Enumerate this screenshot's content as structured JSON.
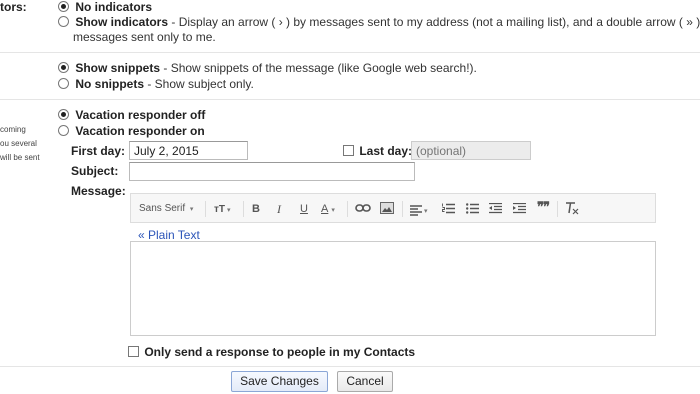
{
  "indicators": {
    "section_label": "tors:",
    "none_label": "No indicators",
    "show_label": "Show indicators",
    "show_desc": " - Display an arrow ( › ) by messages sent to my address (not a mailing list), and a double arrow ( » ) by",
    "show_desc_line2": "messages sent only to me."
  },
  "snippets": {
    "show_label": "Show snippets",
    "show_desc": " - Show snippets of the message (like Google web search!).",
    "none_label": "No snippets",
    "none_desc": " - Show subject only."
  },
  "vacation": {
    "side_lines": [
      "coming",
      "ou several",
      "will be sent"
    ],
    "off_label": "Vacation responder off",
    "on_label": "Vacation responder on",
    "first_day_label": "First day:",
    "first_day_value": "July 2, 2015",
    "last_day_label": "Last day:",
    "last_day_placeholder": "(optional)",
    "subject_label": "Subject:",
    "subject_value": "",
    "message_label": "Message:",
    "plain_text_link": "« Plain Text",
    "contacts_only_label": "Only send a response to people in my Contacts"
  },
  "toolbar": {
    "font_family": "Sans Serif",
    "bold": "B",
    "italic": "I",
    "underline": "U",
    "text_color": "A",
    "quote": "❞❞"
  },
  "actions": {
    "save_label": "Save Changes",
    "cancel_label": "Cancel"
  }
}
